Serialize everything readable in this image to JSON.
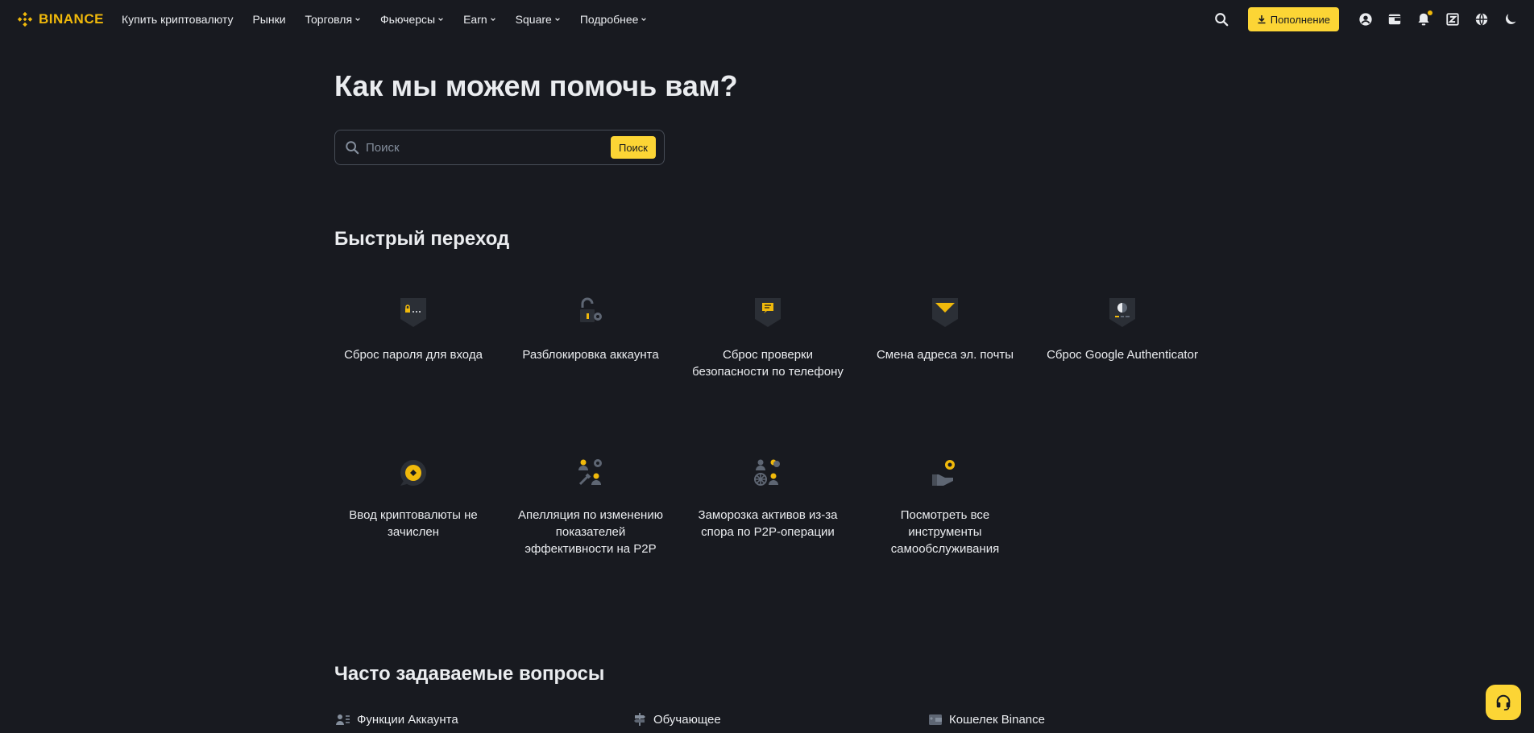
{
  "header": {
    "logo_text": "BINANCE",
    "nav": [
      {
        "label": "Купить криптовалюту",
        "has_dropdown": false
      },
      {
        "label": "Рынки",
        "has_dropdown": false
      },
      {
        "label": "Торговля",
        "has_dropdown": true
      },
      {
        "label": "Фьючерсы",
        "has_dropdown": true
      },
      {
        "label": "Earn",
        "has_dropdown": true
      },
      {
        "label": "Square",
        "has_dropdown": true
      },
      {
        "label": "Подробнее",
        "has_dropdown": true
      }
    ],
    "deposit_label": "Пополнение",
    "icons": [
      "search-icon",
      "download-icon",
      "user-icon",
      "wallet-icon",
      "bell-icon",
      "app-download-icon",
      "globe-icon",
      "theme-toggle-icon"
    ]
  },
  "main": {
    "title": "Как мы можем помочь вам?",
    "search": {
      "placeholder": "Поиск",
      "button_label": "Поиск"
    },
    "quick_title": "Быстрый переход",
    "quick_links": [
      {
        "label": "Сброс пароля для входа",
        "icon": "password-reset-icon"
      },
      {
        "label": "Разблокировка аккаунта",
        "icon": "unlock-icon"
      },
      {
        "label": "Сброс проверки безопасности по телефону",
        "icon": "phone-security-icon"
      },
      {
        "label": "Смена адреса эл. почты",
        "icon": "email-icon"
      },
      {
        "label": "Сброс Google Authenticator",
        "icon": "authenticator-icon"
      },
      {
        "label": "Ввод криптовалюты не зачислен",
        "icon": "deposit-missing-icon"
      },
      {
        "label": "Апелляция по изменению показателей эффективности на P2P",
        "icon": "p2p-appeal-icon"
      },
      {
        "label": "Заморозка активов из-за спора по P2P-операции",
        "icon": "asset-freeze-icon"
      },
      {
        "label": "Посмотреть все инструменты самообслуживания",
        "icon": "self-service-icon"
      }
    ],
    "faq_title": "Часто задаваемые вопросы",
    "faq_categories": [
      {
        "label": "Функции Аккаунта",
        "icon": "account-features-icon"
      },
      {
        "label": "Обучающее",
        "icon": "education-icon"
      },
      {
        "label": "Кошелек Binance",
        "icon": "binance-wallet-icon"
      }
    ]
  },
  "colors": {
    "background": "#181a20",
    "accent": "#fcd535",
    "text": "#eaecef",
    "muted": "#848e9c"
  }
}
